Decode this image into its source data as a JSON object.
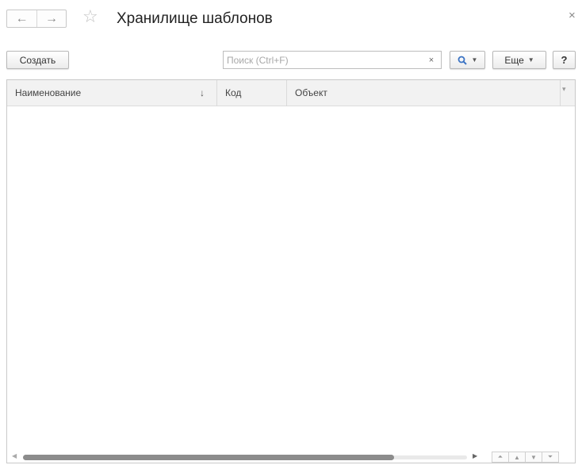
{
  "window": {
    "title": "Хранилище шаблонов",
    "close_glyph": "×",
    "nav_back_glyph": "←",
    "nav_forward_glyph": "→",
    "favorite_glyph": "☆"
  },
  "toolbar": {
    "create_label": "Создать",
    "search_placeholder": "Поиск (Ctrl+F)",
    "search_value": "",
    "clear_glyph": "×",
    "search_icon": "magnifier-icon",
    "more_label": "Еще",
    "help_label": "?"
  },
  "table": {
    "columns": [
      {
        "label": "Наименование",
        "sort": "↓"
      },
      {
        "label": "Код"
      },
      {
        "label": "Объект"
      }
    ],
    "rows": []
  },
  "pager": {
    "first": "⏶",
    "prev": "▲",
    "next": "▼",
    "last": "⏷"
  },
  "colors": {
    "accent": "#3b73c4",
    "border": "#c9c9c9",
    "header_bg": "#f2f2f2"
  }
}
